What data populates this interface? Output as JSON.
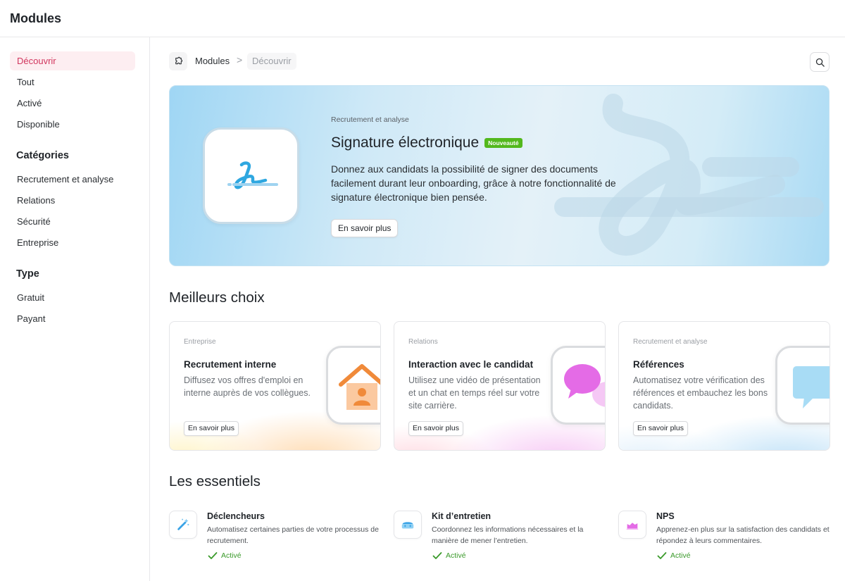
{
  "app": {
    "title": "Modules"
  },
  "sidebar": {
    "items": [
      {
        "label": "Découvrir"
      },
      {
        "label": "Tout"
      },
      {
        "label": "Activé"
      },
      {
        "label": "Disponible"
      }
    ],
    "categories_heading": "Catégories",
    "categories": [
      {
        "label": "Recrutement et analyse"
      },
      {
        "label": "Relations"
      },
      {
        "label": "Sécurité"
      },
      {
        "label": "Entreprise"
      }
    ],
    "type_heading": "Type",
    "types": [
      {
        "label": "Gratuit"
      },
      {
        "label": "Payant"
      }
    ]
  },
  "breadcrumb": {
    "root": "Modules",
    "separator": ">",
    "current": "Découvrir"
  },
  "hero": {
    "category": "Recrutement et analyse",
    "title": "Signature électronique",
    "badge": "Nouveauté",
    "description": "Donnez aux candidats la possibilité de signer des documents facilement durant leur onboarding, grâce à notre fonctionnalité de signature électronique bien pensée.",
    "cta": "En savoir plus"
  },
  "top_picks": {
    "heading": "Meilleurs choix",
    "cards": [
      {
        "category": "Entreprise",
        "title": "Recrutement interne",
        "description": "Diffusez vos offres d'emploi en interne auprès de vos collègues.",
        "cta": "En savoir plus",
        "icon": "house-person-icon"
      },
      {
        "category": "Relations",
        "title": "Interaction avec le candidat",
        "description": "Utilisez une vidéo de présentation et un chat en temps réel sur votre site carrière.",
        "cta": "En savoir plus",
        "icon": "chat-bubbles-icon"
      },
      {
        "category": "Recrutement et analyse",
        "title": "Références",
        "description": "Automatisez votre vérification des références et embauchez les bons candidats.",
        "cta": "En savoir plus",
        "icon": "speech-bubble-icon"
      }
    ]
  },
  "essentials": {
    "heading": "Les essentiels",
    "items": [
      {
        "title": "Déclencheurs",
        "description": "Automatisez certaines parties de votre processus de recrutement.",
        "status": "Activé",
        "icon": "magic-wand-icon"
      },
      {
        "title": "Kit d’entretien",
        "description": "Coordonnez les informations nécessaires et la manière de mener l’entretien.",
        "status": "Activé",
        "icon": "toolkit-icon"
      },
      {
        "title": "NPS",
        "description": "Apprenez-en plus sur la satisfaction des candidats et répondez à leurs commentaires.",
        "status": "Activé",
        "icon": "nps-chart-icon"
      }
    ]
  },
  "colors": {
    "accent": "#d1365e",
    "accent_bg": "#fdeef1",
    "success": "#3a9a2a",
    "badge": "#52b81d"
  }
}
